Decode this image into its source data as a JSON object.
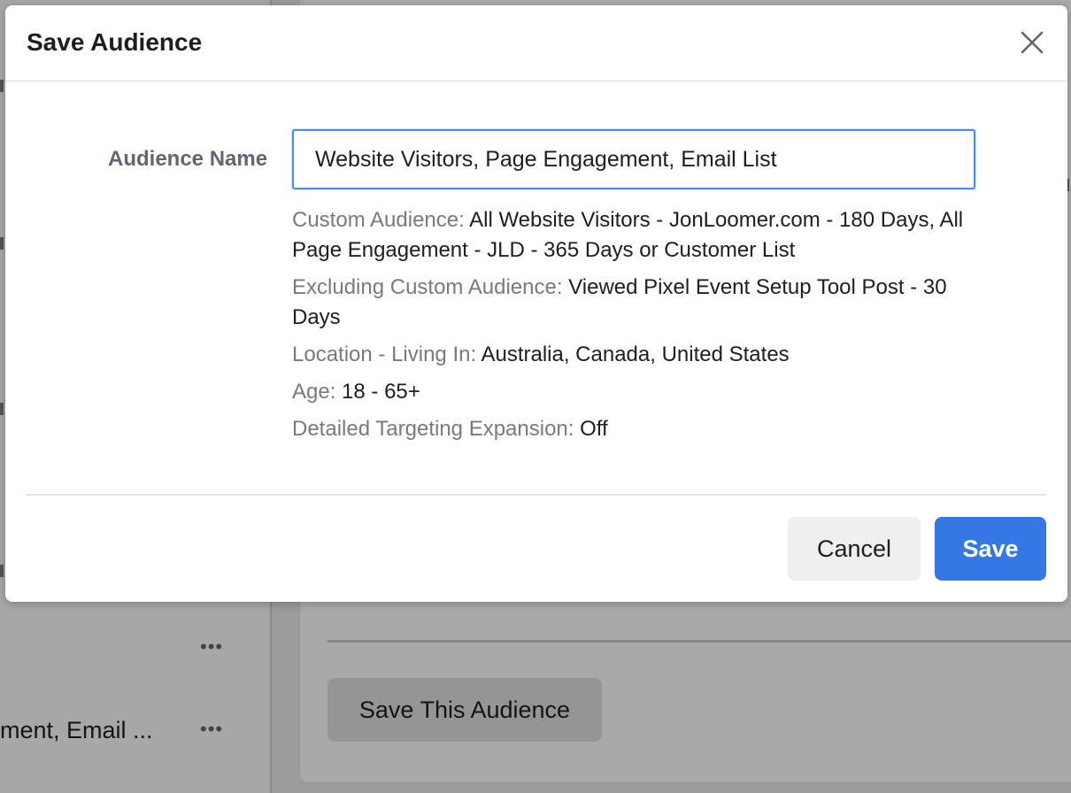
{
  "modal": {
    "title": "Save Audience",
    "name_label": "Audience Name",
    "name_value": "Website Visitors, Page Engagement, Email List",
    "summary": [
      {
        "key": "Custom Audience: ",
        "value": "All Website Visitors - JonLoomer.com - 180 Days, All Page Engagement - JLD - 365 Days or Customer List"
      },
      {
        "key": "Excluding Custom Audience: ",
        "value": "Viewed Pixel Event Setup Tool Post - 30 Days"
      },
      {
        "key": "Location - Living In: ",
        "value": "Australia, Canada, United States"
      },
      {
        "key": "Age: ",
        "value": "18 - 65+"
      },
      {
        "key": "Detailed Targeting Expansion: ",
        "value": "Off"
      }
    ],
    "cancel_label": "Cancel",
    "save_label": "Save"
  },
  "background": {
    "save_this_audience_label": "Save This Audience",
    "row_text": "ment, Email ...",
    "more_label": "•••"
  }
}
